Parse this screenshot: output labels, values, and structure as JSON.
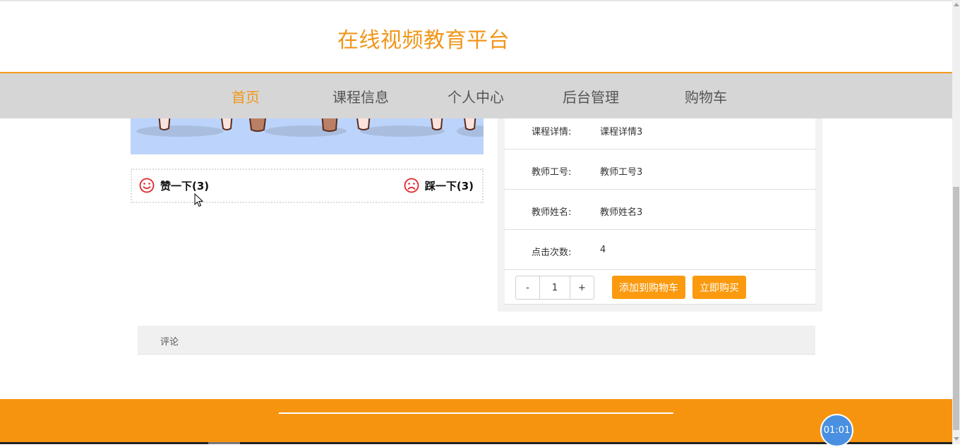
{
  "site": {
    "title": "在线视频教育平台"
  },
  "nav": {
    "items": [
      {
        "label": "首页",
        "active": true
      },
      {
        "label": "课程信息",
        "active": false
      },
      {
        "label": "个人中心",
        "active": false
      },
      {
        "label": "后台管理",
        "active": false
      },
      {
        "label": "购物车",
        "active": false
      }
    ]
  },
  "votes": {
    "like_label": "赞一下(3)",
    "dislike_label": "踩一下(3)"
  },
  "details": {
    "rows": [
      {
        "label": "课程详情:",
        "value": "课程详情3"
      },
      {
        "label": "教师工号:",
        "value": "教师工号3"
      },
      {
        "label": "教师姓名:",
        "value": "教师姓名3"
      },
      {
        "label": "点击次数:",
        "value": "4"
      }
    ]
  },
  "purchase": {
    "decrement": "-",
    "quantity": "1",
    "increment": "+",
    "add_to_cart_label": "添加到购物车",
    "buy_now_label": "立即购买"
  },
  "comment": {
    "label": "评论"
  },
  "timer": {
    "text": "01:01"
  },
  "colors": {
    "accent": "#f0961a",
    "button": "#fb9a0e",
    "footer": "#f7940f",
    "nav_bg": "#d6d6d6",
    "vote_icon": "#e0252a",
    "timer_bg": "#4a90e2"
  },
  "icons": {
    "like": "smile-icon",
    "dislike": "frown-icon",
    "cursor": "mouse-pointer-icon"
  }
}
